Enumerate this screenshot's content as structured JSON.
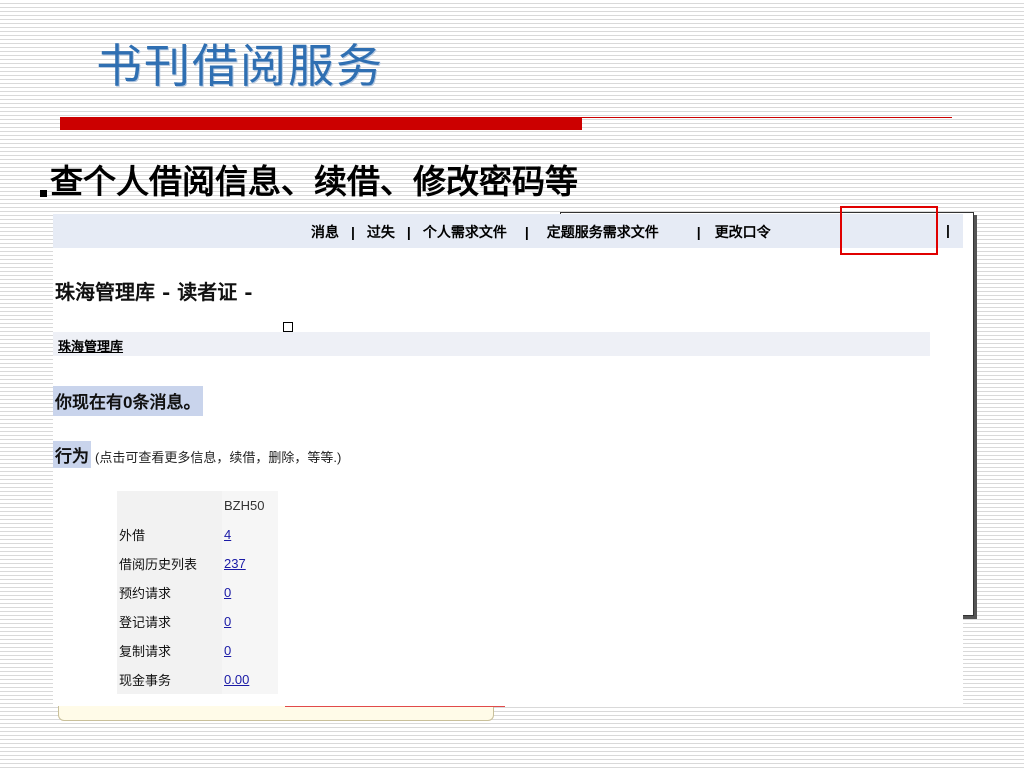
{
  "slide": {
    "title": "书刊借阅服务",
    "bullet": "查个人借阅信息、续借、修改密码等"
  },
  "nav": {
    "items": [
      "消息",
      "过失",
      "个人需求文件",
      "定题服务需求文件",
      "更改口令"
    ]
  },
  "page": {
    "heading": "珠海管理库 - 读者证 -",
    "library_link": "珠海管理库",
    "message": "你现在有0条消息。",
    "action_label": "行为",
    "action_note": "(点击可查看更多信息，续借，删除，等等.)"
  },
  "stats": {
    "column_header": "BZH50",
    "rows": [
      {
        "label": "外借",
        "value": "4"
      },
      {
        "label": "借阅历史列表",
        "value": "237"
      },
      {
        "label": "预约请求",
        "value": "0"
      },
      {
        "label": "登记请求",
        "value": "0"
      },
      {
        "label": "复制请求",
        "value": "0"
      },
      {
        "label": "现金事务",
        "value": "0.00"
      }
    ]
  },
  "colors": {
    "title": "#2f6fb2",
    "accent_red": "#cc0000",
    "nav_bg": "#e6ebf5",
    "highlight": "#e00000"
  }
}
